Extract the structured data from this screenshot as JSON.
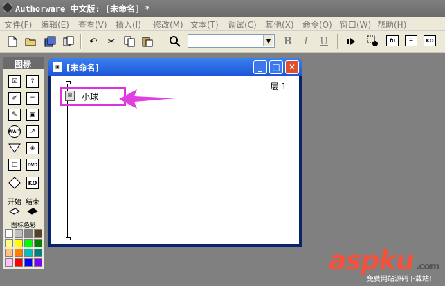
{
  "app": {
    "title": "Authorware 中文版: [未命名] *"
  },
  "menu": [
    {
      "label": "文件(F)"
    },
    {
      "label": "编辑(E)"
    },
    {
      "label": "查看(V)"
    },
    {
      "label": "插入(I)"
    },
    {
      "label": "修改(M)"
    },
    {
      "label": "文本(T)"
    },
    {
      "label": "调试(C)"
    },
    {
      "label": "其他(X)"
    },
    {
      "label": "命令(O)"
    },
    {
      "label": "窗口(W)"
    },
    {
      "label": "帮助(H)"
    }
  ],
  "toolbar": {
    "font_value": "",
    "bold_label": "B",
    "italic_label": "I",
    "underline_label": "U",
    "icons": [
      "new-icon",
      "open-icon",
      "save-all-icon",
      "import-icon",
      "undo-icon",
      "cut-icon",
      "copy-icon",
      "paste-icon",
      "find-icon",
      "text-style-dropdown",
      "bold-icon",
      "italic-icon",
      "underline-icon",
      "run-icon",
      "control-panel-icon",
      "functions-icon",
      "variables-icon",
      "knowledge-objects-icon"
    ]
  },
  "palette": {
    "title": "图标",
    "start_label": "开始",
    "end_label": "结束",
    "colors_label": "图标色彩",
    "icons": [
      {
        "name": "display-icon",
        "glyph": "☒"
      },
      {
        "name": "motion-icon",
        "glyph": "?"
      },
      {
        "name": "erase-icon",
        "glyph": "✐"
      },
      {
        "name": "wait-icon",
        "glyph": "═"
      },
      {
        "name": "navigate-icon",
        "glyph": "✎"
      },
      {
        "name": "framework-icon",
        "glyph": "▣"
      },
      {
        "name": "decision-icon",
        "glyph": "WAIT"
      },
      {
        "name": "interaction-icon",
        "glyph": "↗"
      },
      {
        "name": "calculation-icon",
        "glyph": "▽"
      },
      {
        "name": "map-icon",
        "glyph": "◈"
      },
      {
        "name": "digital-movie-icon",
        "glyph": "□"
      },
      {
        "name": "sound-icon",
        "glyph": "DVD"
      },
      {
        "name": "video-icon",
        "glyph": "◇"
      },
      {
        "name": "knowledge-object-icon",
        "glyph": "KO"
      }
    ],
    "swatches": [
      "#ffffff",
      "#c0c0c0",
      "#808080",
      "#000000",
      "#ffff80",
      "#ffff00",
      "#80ff80",
      "#00ff00",
      "#ff8000",
      "#c08040",
      "#00c0c0",
      "#008080",
      "#ffc0c0",
      "#ff80ff",
      "#ff00ff",
      "#8080ff",
      "#c0c0ff",
      "#ff0000",
      "#0000ff",
      "#000080"
    ]
  },
  "design_window": {
    "title": "[未命名]",
    "layer_label": "层 1",
    "icon_name": "小球"
  },
  "watermark": {
    "logo": "aspku",
    "logo_suffix": ".com",
    "subtitle": "免费网站源码下载站!"
  },
  "colors": {
    "accent": "#1c55d8",
    "highlight_border": "#dd33dd",
    "arrow": "#e040e0"
  }
}
